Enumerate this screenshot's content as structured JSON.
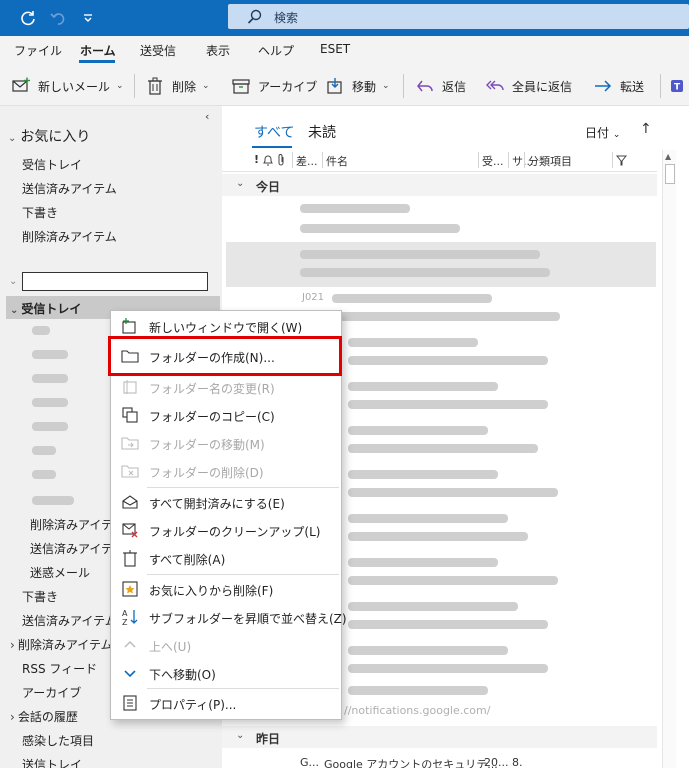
{
  "titlebar": {
    "search_placeholder": "検索",
    "icons": [
      "sync-icon",
      "undo-icon",
      "quick-access-dropdown-icon",
      "search-icon"
    ]
  },
  "ribbon_tabs": [
    {
      "label": "ファイル"
    },
    {
      "label": "ホーム",
      "active": true
    },
    {
      "label": "送受信"
    },
    {
      "label": "表示"
    },
    {
      "label": "ヘルプ"
    },
    {
      "label": "ESET"
    }
  ],
  "commands": {
    "new_mail": "新しいメール",
    "delete": "削除",
    "archive": "アーカイブ",
    "move": "移動",
    "reply": "返信",
    "reply_all": "全員に返信",
    "forward": "転送"
  },
  "favorites": {
    "header": "お気に入り",
    "items": [
      "受信トレイ",
      "送信済みアイテム",
      "下書き",
      "削除済みアイテム"
    ]
  },
  "folders": {
    "inbox": "受信トレイ",
    "sub_items": [
      "削除済みアイテム",
      "送信済みアイテム",
      "迷惑メール"
    ],
    "items": [
      "下書き",
      "送信済みアイテム",
      "削除済みアイテム",
      "RSS フィード",
      "アーカイブ",
      "会話の履歴",
      "感染した項目",
      "送信トレイ"
    ]
  },
  "list": {
    "filter_all": "すべて",
    "filter_unread": "未読",
    "sort_by": "日付",
    "columns": {
      "sender": "差...",
      "subject": "件名",
      "received": "受...",
      "size": "サ...",
      "category": "分類項目"
    },
    "group_today": "今日",
    "group_yesterday": "昨日",
    "partial_sender": "J021",
    "visible_url": "//notifications.google.com/",
    "last_message": {
      "sender": "G...",
      "subject": "Google アカウントのセキュリテ...",
      "received": "20...",
      "size": "8."
    }
  },
  "context_menu": {
    "items": [
      {
        "label": "新しいウィンドウで開く(W)",
        "enabled": true,
        "icon": "new-window-icon"
      },
      {
        "label": "フォルダーの作成(N)...",
        "enabled": true,
        "icon": "folder-icon",
        "highlighted": true
      },
      {
        "label": "フォルダー名の変更(R)",
        "enabled": false,
        "icon": "rename-folder-icon"
      },
      {
        "label": "フォルダーのコピー(C)",
        "enabled": true,
        "icon": "copy-folder-icon"
      },
      {
        "label": "フォルダーの移動(M)",
        "enabled": false,
        "icon": "move-folder-icon"
      },
      {
        "label": "フォルダーの削除(D)",
        "enabled": false,
        "icon": "delete-folder-icon"
      },
      {
        "label": "すべて開封済みにする(E)",
        "enabled": true,
        "icon": "mark-read-icon"
      },
      {
        "label": "フォルダーのクリーンアップ(L)",
        "enabled": true,
        "icon": "cleanup-folder-icon"
      },
      {
        "label": "すべて削除(A)",
        "enabled": true,
        "icon": "delete-all-icon"
      },
      {
        "label": "お気に入りから削除(F)",
        "enabled": true,
        "icon": "remove-favorite-icon"
      },
      {
        "label": "サブフォルダーを昇順で並べ替え(Z)",
        "enabled": true,
        "icon": "sort-az-icon"
      },
      {
        "label": "上へ(U)",
        "enabled": false,
        "icon": "chevron-up-icon"
      },
      {
        "label": "下へ移動(O)",
        "enabled": true,
        "icon": "chevron-down-icon"
      },
      {
        "label": "プロパティ(P)...",
        "enabled": true,
        "icon": "properties-icon"
      }
    ]
  },
  "colors": {
    "titlebar": "#0f6cbd",
    "search_box": "#c7dcf2",
    "accent": "#0f6cbd",
    "highlight_box": "#e00000"
  }
}
